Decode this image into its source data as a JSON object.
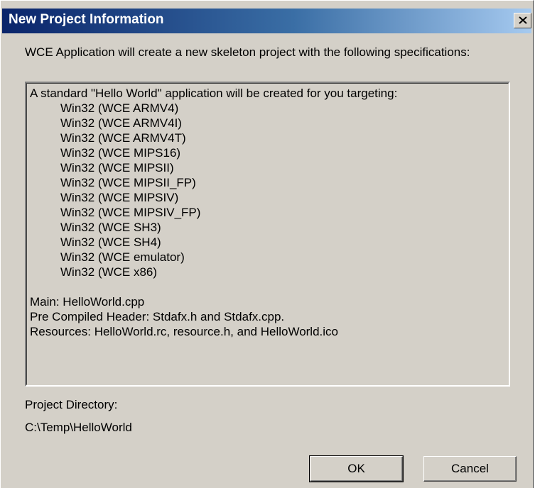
{
  "window": {
    "title": "New Project Information"
  },
  "intro_text": "WCE Application will create a new skeleton project with the following specifications:",
  "info": {
    "header": "A standard \"Hello World\" application will be created for you targeting:",
    "targets": [
      "Win32 (WCE ARMV4)",
      "Win32 (WCE ARMV4I)",
      "Win32 (WCE ARMV4T)",
      "Win32 (WCE MIPS16)",
      "Win32 (WCE MIPSII)",
      "Win32 (WCE MIPSII_FP)",
      "Win32 (WCE MIPSIV)",
      "Win32 (WCE MIPSIV_FP)",
      "Win32 (WCE SH3)",
      "Win32 (WCE SH4)",
      "Win32 (WCE emulator)",
      "Win32 (WCE x86)"
    ],
    "main": "Main: HelloWorld.cpp",
    "pch": "Pre Compiled Header: Stdafx.h and Stdafx.cpp.",
    "resources": "Resources: HelloWorld.rc, resource.h, and HelloWorld.ico"
  },
  "project_directory": {
    "label": "Project Directory:",
    "value": "C:\\Temp\\HelloWorld"
  },
  "buttons": {
    "ok": "OK",
    "cancel": "Cancel"
  },
  "icons": {
    "close": "close-icon"
  },
  "colors": {
    "title_bar_start": "#0a246a",
    "title_bar_end": "#a6caf0",
    "dialog_face": "#d4d0c8"
  }
}
